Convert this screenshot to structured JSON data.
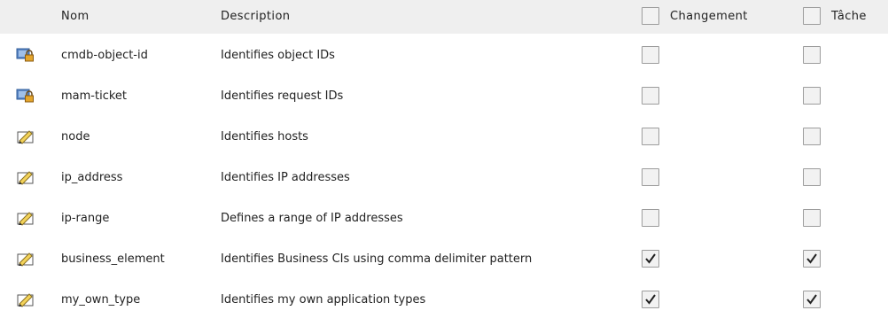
{
  "header": {
    "name": "Nom",
    "description": "Description",
    "change": "Changement",
    "task": "Tâche"
  },
  "rows": [
    {
      "icon": "lock-icon",
      "name": "cmdb-object-id",
      "description": "Identifies object IDs",
      "change": false,
      "task": false
    },
    {
      "icon": "lock-icon",
      "name": "mam-ticket",
      "description": "Identifies request IDs",
      "change": false,
      "task": false
    },
    {
      "icon": "pencil-icon",
      "name": "node",
      "description": "Identifies hosts",
      "change": false,
      "task": false
    },
    {
      "icon": "pencil-icon",
      "name": "ip_address",
      "description": "Identifies IP addresses",
      "change": false,
      "task": false
    },
    {
      "icon": "pencil-icon",
      "name": "ip-range",
      "description": "Defines a range of IP addresses",
      "change": false,
      "task": false
    },
    {
      "icon": "pencil-icon",
      "name": "business_element",
      "description": "Identifies Business CIs using comma delimiter pattern",
      "change": true,
      "task": true
    },
    {
      "icon": "pencil-icon",
      "name": "my_own_type",
      "description": "Identifies my own application types",
      "change": true,
      "task": true
    }
  ]
}
